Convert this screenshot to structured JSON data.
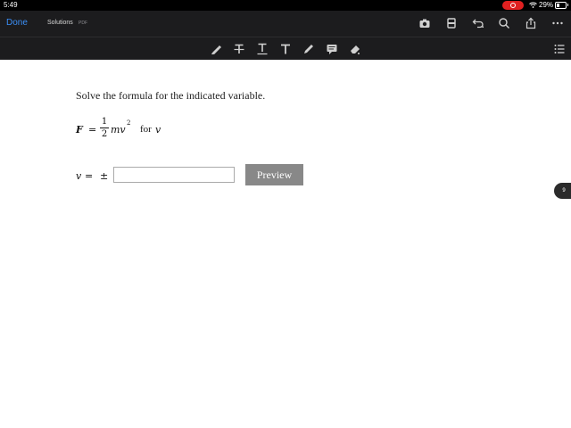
{
  "status_bar": {
    "time": "5:49",
    "battery": "29%"
  },
  "toolbar": {
    "done_label": "Done",
    "doc_title": "Solutions",
    "doc_type": "PDF",
    "icons": [
      "camera-icon",
      "scan-icon",
      "undo-icon",
      "search-icon",
      "share-icon",
      "more-icon"
    ]
  },
  "annotation_toolbar": {
    "icons": [
      "highlighter-icon",
      "strikethrough-icon",
      "underline-icon",
      "text-icon",
      "pen-icon",
      "comment-icon",
      "eraser-icon",
      "list-icon"
    ]
  },
  "problem": {
    "instruction": "Solve the formula for the indicated variable.",
    "formula": {
      "lhs": "F",
      "equals": "=",
      "frac_num": "1",
      "frac_den": "2",
      "term": "mv",
      "exponent": "2",
      "for_text": "for",
      "for_var": "v"
    },
    "answer": {
      "var": "v",
      "equals": "=",
      "plus_minus": "±",
      "input_value": "",
      "preview_label": "Preview"
    }
  },
  "page_indicator": "9"
}
